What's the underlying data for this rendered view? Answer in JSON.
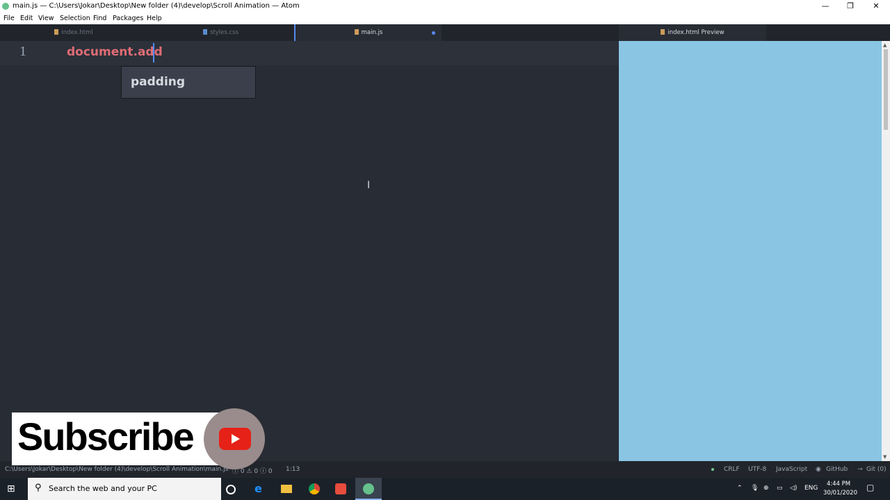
{
  "window": {
    "title": "main.js — C:\\Users\\Jokar\\Desktop\\New folder (4)\\develop\\Scroll Animation — Atom",
    "minimize": "—",
    "restore": "❐",
    "close": "✕"
  },
  "menu": [
    "File",
    "Edit",
    "View",
    "Selection",
    "Find",
    "Packages",
    "Help"
  ],
  "tabs": [
    {
      "label": "index.html"
    },
    {
      "label": "styles.css"
    },
    {
      "label": "main.js"
    }
  ],
  "preview_tab": {
    "label": "index.html Preview"
  },
  "editor": {
    "line_number": "1",
    "code": "document.add",
    "autocomplete": "padding"
  },
  "status": {
    "path": "C:\\Users\\Jokar\\Desktop\\New folder (4)\\develop\\Scroll Animation\\main.js*",
    "diagnostics": "ⓘ 0 ⚠ 0 ⓘ 0",
    "cursor": "1:13",
    "line_ending": "CRLF",
    "encoding": "UTF-8",
    "grammar": "JavaScript",
    "github": "GitHub",
    "git": "Git (0)"
  },
  "overlay": {
    "subscribe": "Subscribe"
  },
  "taskbar": {
    "search_placeholder": "Search the web and your PC",
    "language": "ENG",
    "time": "4:44 PM",
    "date": "30/01/2020"
  },
  "colors": {
    "editor_bg": "#282c34",
    "preview_bg": "#8ac6e4",
    "code_color": "#e06c75",
    "accent": "#568af2"
  }
}
